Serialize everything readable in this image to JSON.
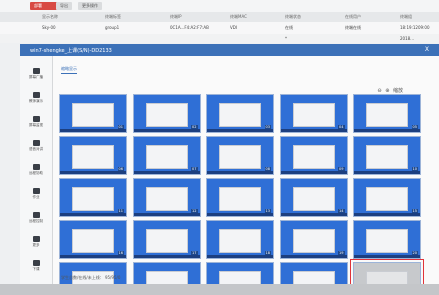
{
  "toolbar": {
    "buttons": [
      "部署",
      "导出",
      "更多操作"
    ]
  },
  "columns": [
    "显示名称",
    "终端标签",
    "终端IP",
    "终端MAC",
    "终端状态",
    "在线用户",
    "终端组"
  ],
  "rows": [
    {
      "name": "Sky-00",
      "group": "group1",
      "mac": "0C1A...F4:A2:F7:AB",
      "os": "VDI",
      "status": "在线",
      "user": "终端在线",
      "time": "18:19:1209:00"
    },
    {
      "name": "",
      "status": "*",
      "time": "2018..."
    }
  ],
  "window": {
    "title": "win7-shengke_上课(S/N)-DD2133",
    "close": "X"
  },
  "sidebar": {
    "items": [
      "屏幕广播",
      "教师演示",
      "屏幕监视",
      "语音对讲",
      "远程协助",
      "作业",
      "远程控制",
      "更多",
      "下课"
    ]
  },
  "main": {
    "tab": "缩略显示",
    "zoom": {
      "out": "⊖",
      "in": "⊕",
      "label": "缩放"
    }
  },
  "thumbnails": [
    {
      "num": "01"
    },
    {
      "num": "02"
    },
    {
      "num": "03"
    },
    {
      "num": "04"
    },
    {
      "num": "05"
    },
    {
      "num": "06"
    },
    {
      "num": "07"
    },
    {
      "num": "08"
    },
    {
      "num": "09"
    },
    {
      "num": "10"
    },
    {
      "num": "11"
    },
    {
      "num": "12"
    },
    {
      "num": "13"
    },
    {
      "num": "14"
    },
    {
      "num": "15"
    },
    {
      "num": "16"
    },
    {
      "num": "17"
    },
    {
      "num": "18"
    },
    {
      "num": "19"
    },
    {
      "num": "20"
    },
    {
      "num": "21"
    },
    {
      "num": "22"
    },
    {
      "num": "23"
    },
    {
      "num": "24"
    },
    {
      "num": "25"
    }
  ],
  "selected_thumb": 25,
  "footer": "学生总数/在线/未上线：  95/95/0",
  "colors": {
    "accent": "#3c71b8",
    "highlight": "#e0333a",
    "desktop": "#2f6fd6"
  }
}
